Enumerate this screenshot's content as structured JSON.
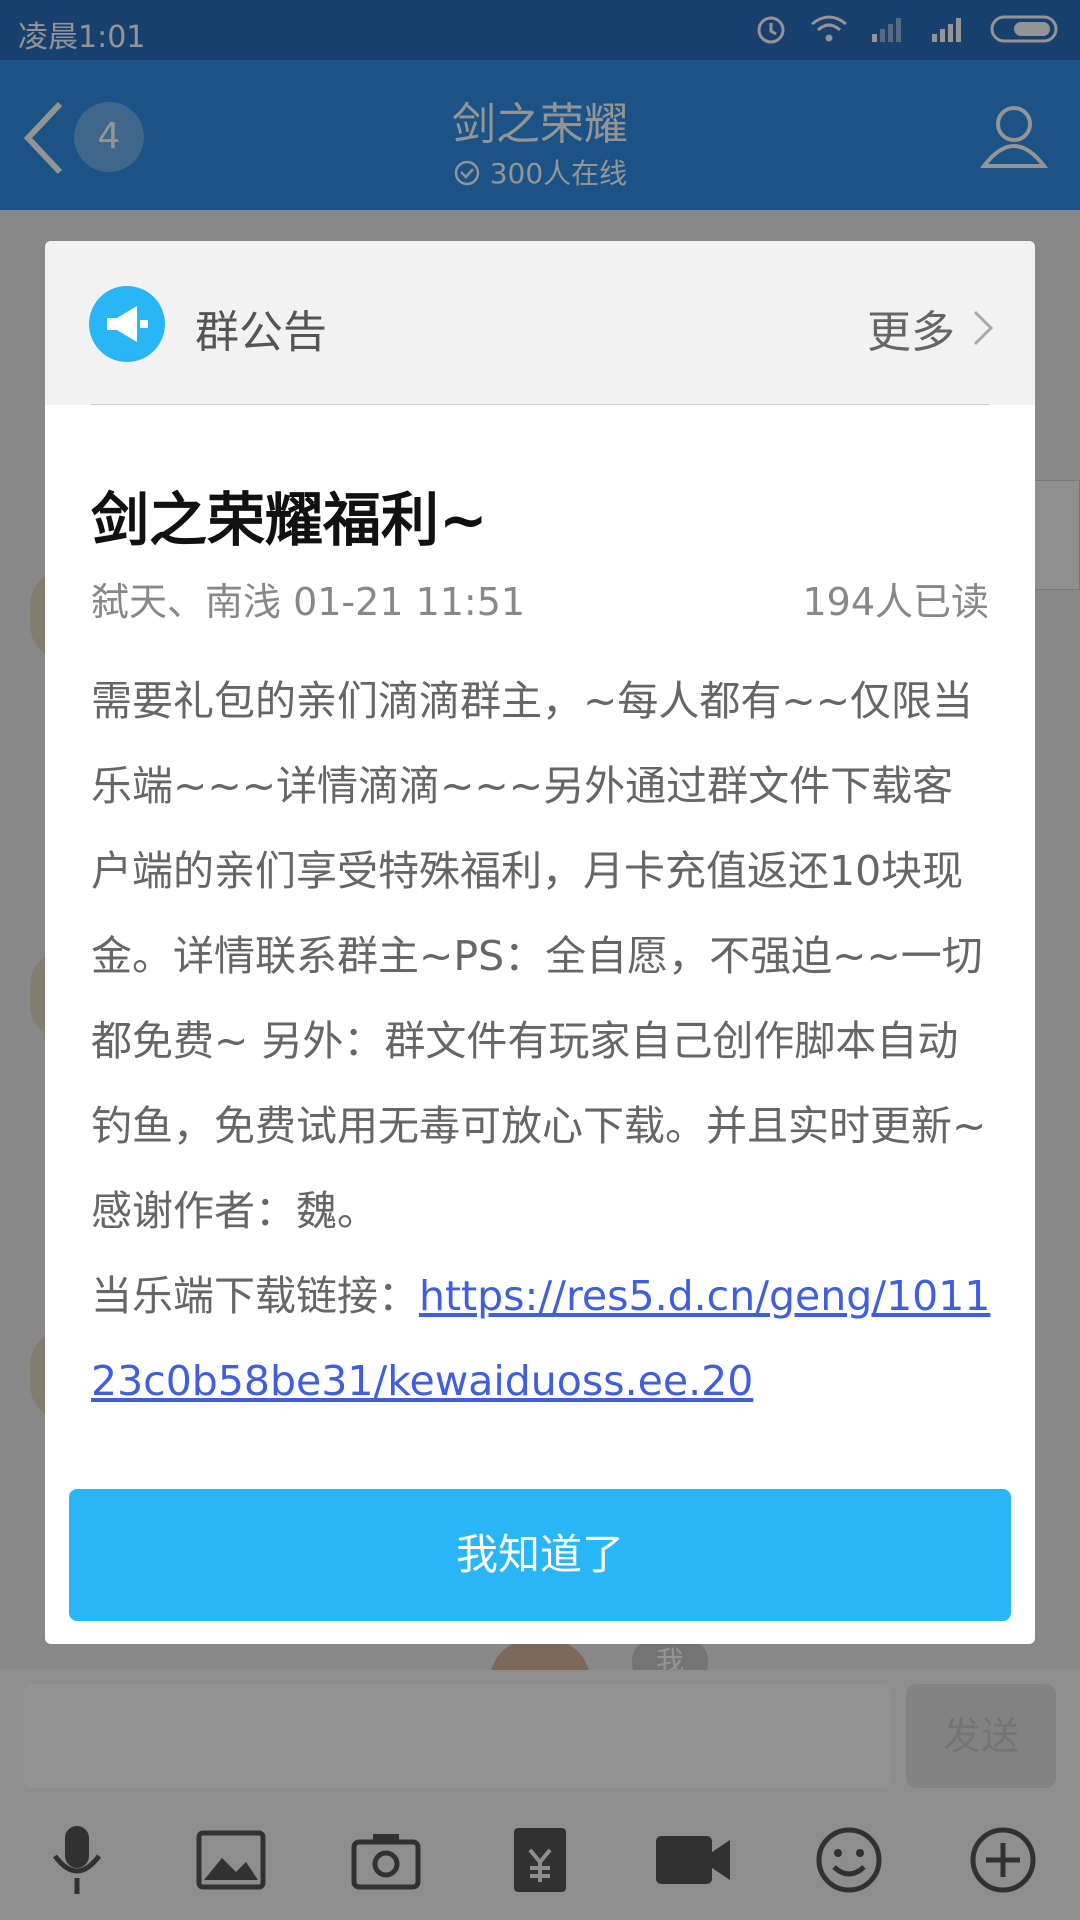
{
  "statusbar": {
    "time": "凌晨1:01"
  },
  "header": {
    "title": "剑之荣耀",
    "online": "300人在线",
    "unread_count": "4"
  },
  "chat": {
    "me_label": "我"
  },
  "input": {
    "send_label": "发送"
  },
  "dialog": {
    "header_label": "群公告",
    "more_label": "更多",
    "title": "剑之荣耀福利~",
    "author_time": "弑天、南浅 01-21 11:51",
    "read_count": "194人已读",
    "body": "需要礼包的亲们滴滴群主，~每人都有~~仅限当乐端~~~详情滴滴~~~另外通过群文件下载客户端的亲们享受特殊福利，月卡充值返还10块现金。详情联系群主~PS：全自愿，不强迫~~一切都免费~ 另外：群文件有玩家自己创作脚本自动钓鱼，免费试用无毒可放心下载。并且实时更新~感谢作者：魏。",
    "link_prefix": "当乐端下载链接：",
    "link_text": "https://res5.d.cn/geng/101123c0b58be31/kewaiduoss.ee.20",
    "confirm_label": "我知道了"
  },
  "colors": {
    "accent": "#29b6f6",
    "header_blue": "#2f8fe8",
    "link": "#3f5ee0"
  }
}
